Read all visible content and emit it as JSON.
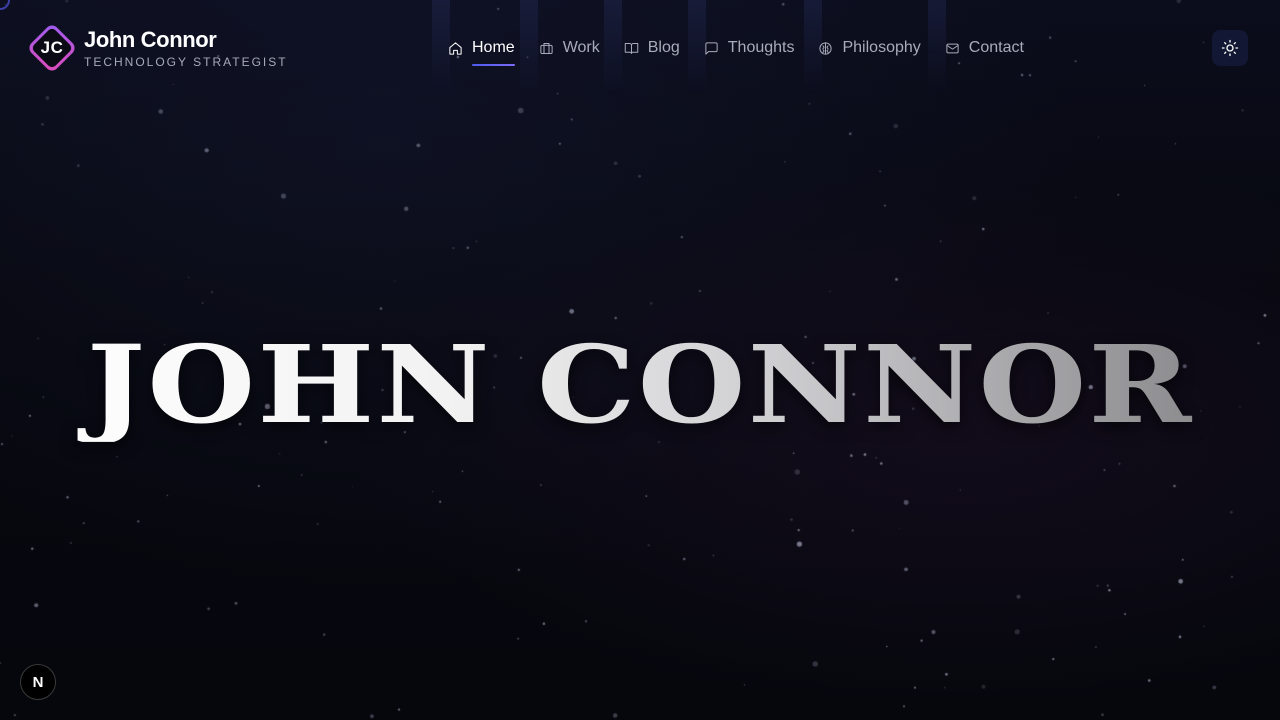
{
  "brand": {
    "logo_initials": "JC",
    "name": "John Connor",
    "subtitle": "TECHNOLOGY STRATEGIST"
  },
  "nav": {
    "items": [
      {
        "label": "Home",
        "icon": "home-icon",
        "active": true
      },
      {
        "label": "Work",
        "icon": "briefcase-icon",
        "active": false
      },
      {
        "label": "Blog",
        "icon": "book-open-icon",
        "active": false
      },
      {
        "label": "Thoughts",
        "icon": "message-square-icon",
        "active": false
      },
      {
        "label": "Philosophy",
        "icon": "brain-icon",
        "active": false
      },
      {
        "label": "Contact",
        "icon": "mail-icon",
        "active": false
      }
    ]
  },
  "theme_toggle": {
    "icon": "sun-icon"
  },
  "hero": {
    "title": "JOHN CONNOR"
  },
  "dev_badge": {
    "label": "N",
    "icon": "nextjs-icon"
  },
  "colors": {
    "background": "#07080f",
    "accent": "#4f5bf0",
    "logo_gradient_start": "#9a5cf0",
    "logo_gradient_end": "#e04bb8",
    "nav_text": "#a8abb9",
    "nav_active": "#ffffff",
    "toggle_bg": "#121733"
  }
}
